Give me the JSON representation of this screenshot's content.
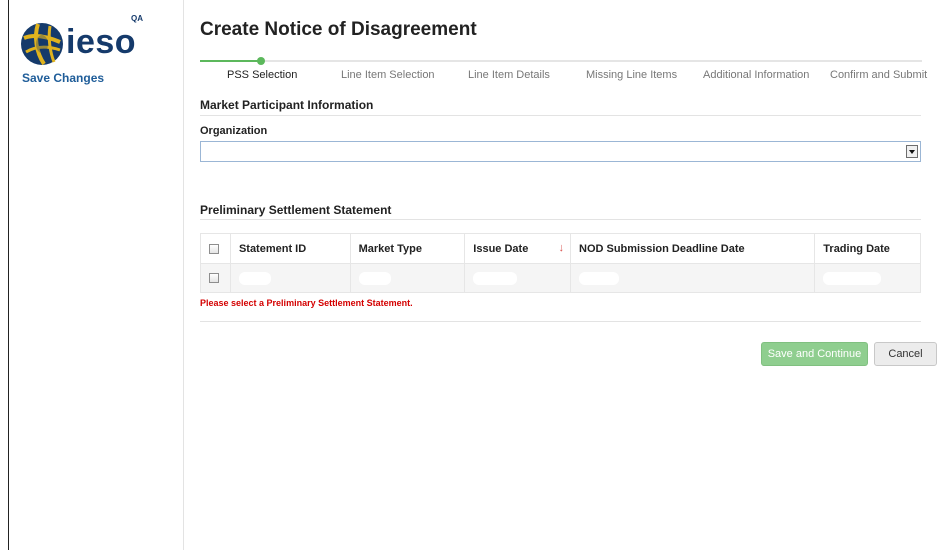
{
  "sidebar": {
    "logo_text": "ieso",
    "environment_badge": "QA",
    "save_changes": "Save Changes"
  },
  "page": {
    "title": "Create Notice of Disagreement"
  },
  "wizard": {
    "steps": [
      {
        "label": "PSS Selection",
        "active": true
      },
      {
        "label": "Line Item Selection",
        "active": false
      },
      {
        "label": "Line Item Details",
        "active": false
      },
      {
        "label": "Missing Line Items",
        "active": false
      },
      {
        "label": "Additional Information",
        "active": false
      },
      {
        "label": "Confirm and Submit",
        "active": false
      }
    ]
  },
  "market_participant": {
    "section_title": "Market Participant Information",
    "organization_label": "Organization",
    "organization_value": ""
  },
  "pss": {
    "section_title": "Preliminary Settlement Statement",
    "columns": [
      "Statement ID",
      "Market Type",
      "Issue Date",
      "NOD Submission Deadline Date",
      "Trading Date"
    ],
    "sort_indicator": "↓",
    "rows": [
      {
        "statement_id": "",
        "market_type": "",
        "issue_date": "",
        "nod_deadline": "",
        "trading_date": ""
      }
    ],
    "error": "Please select a Preliminary Settlement Statement."
  },
  "actions": {
    "save_continue": "Save and Continue",
    "cancel": "Cancel"
  },
  "colors": {
    "brand_navy": "#153a6b",
    "link_blue": "#1f5d99",
    "wizard_green": "#5cb85c",
    "error_red": "#d40000",
    "button_green": "#8fce8f"
  }
}
